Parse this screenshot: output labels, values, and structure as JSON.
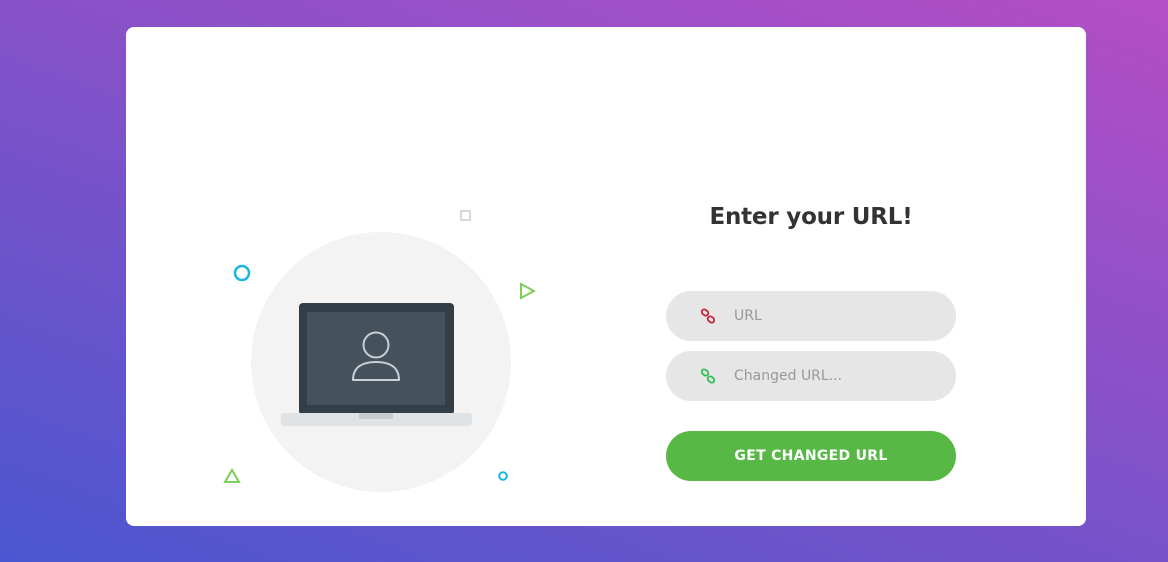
{
  "form": {
    "title": "Enter your URL!",
    "url_placeholder": "URL",
    "changed_url_placeholder": "Changed URL...",
    "url_value": "",
    "changed_url_value": "",
    "submit_label": "GET CHANGED URL"
  },
  "icons": {
    "url_field_icon": "link-icon",
    "changed_url_field_icon": "link-icon",
    "illustration": "laptop-user-icon"
  },
  "colors": {
    "background_gradient": [
      "#4a57d0",
      "#b54ec6"
    ],
    "button": "#57b846",
    "url_icon": "#c8233b",
    "changed_url_icon": "#2fbf56",
    "input_background": "#e6e6e6",
    "illustration_circle": "#f3f3f3",
    "laptop_frame": "#333f48",
    "laptop_screen": "#45525c"
  }
}
